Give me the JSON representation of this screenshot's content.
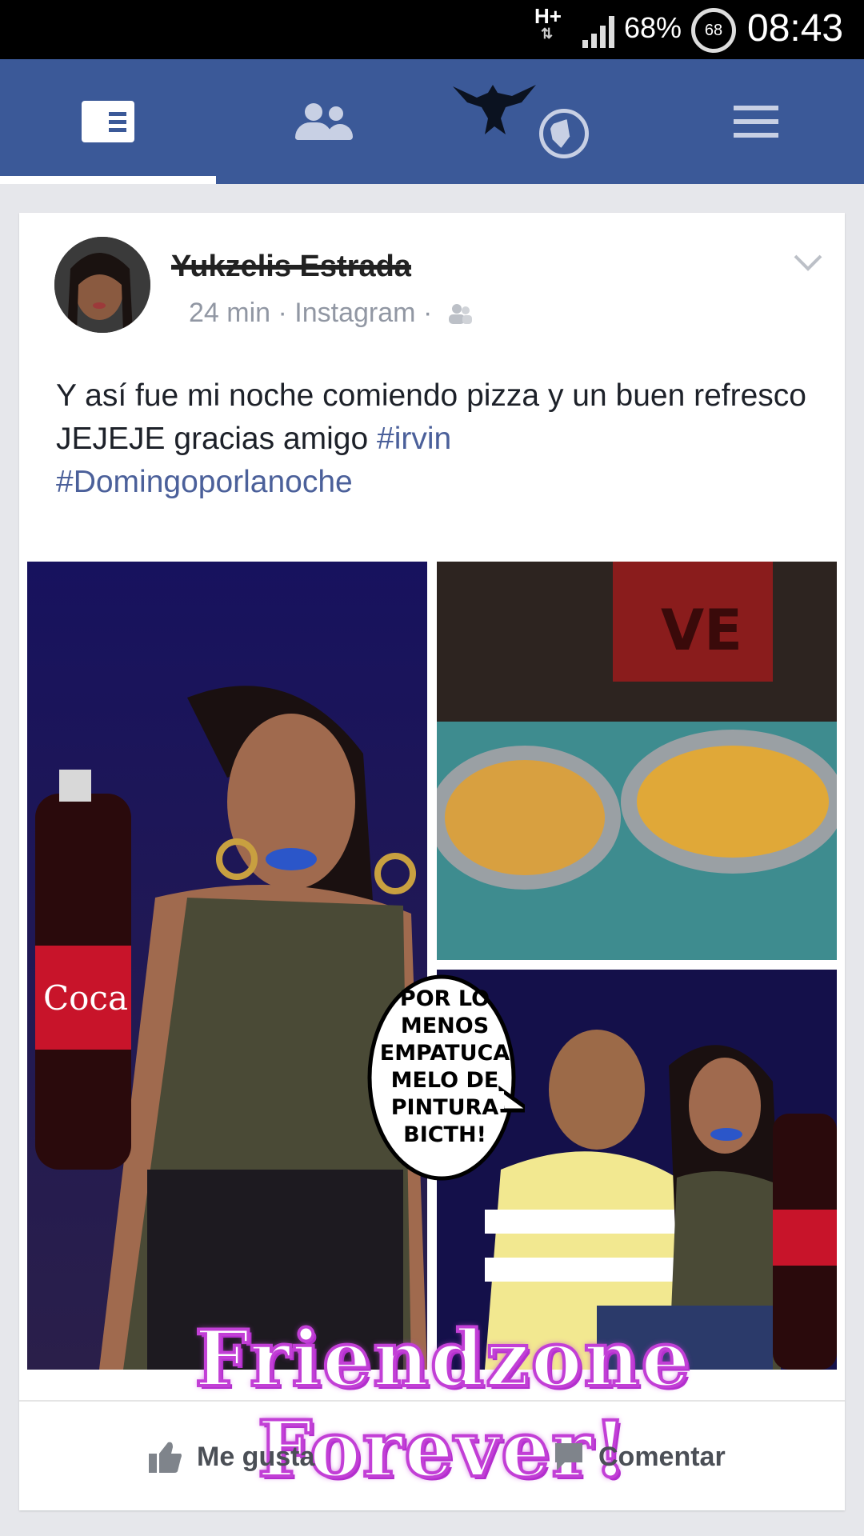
{
  "status_bar": {
    "network": "H+",
    "battery_percent": "68%",
    "battery_ring": "68",
    "time": "08:43"
  },
  "nav": {
    "tabs": [
      {
        "name": "news-feed",
        "icon": "news-feed-icon",
        "active": true
      },
      {
        "name": "friends",
        "icon": "friends-icon"
      },
      {
        "name": "notifications",
        "icon": "globe-icon"
      },
      {
        "name": "menu",
        "icon": "hamburger-menu-icon"
      }
    ]
  },
  "post": {
    "author": "Yukzelis Estrada",
    "time": "24 min",
    "separator": "·",
    "source": "Instagram",
    "text_main": "Y así fue mi noche comiendo pizza y un buen refresco JEJEJE gracias amigo ",
    "hashtag_1": "#irvin",
    "hashtag_2": "#Domingoporlanoche",
    "speech_bubble": "POR LO MENOS EMPATUCA MELO DE PINTURA BICTH!",
    "overlay_caption": "Friendzone Forever!",
    "actions": {
      "like": "Me gusta",
      "comment": "Comentar"
    }
  },
  "colors": {
    "brand": "#3b5998",
    "hashtag": "#4b609a",
    "caption_glow": "#c23fd6"
  }
}
